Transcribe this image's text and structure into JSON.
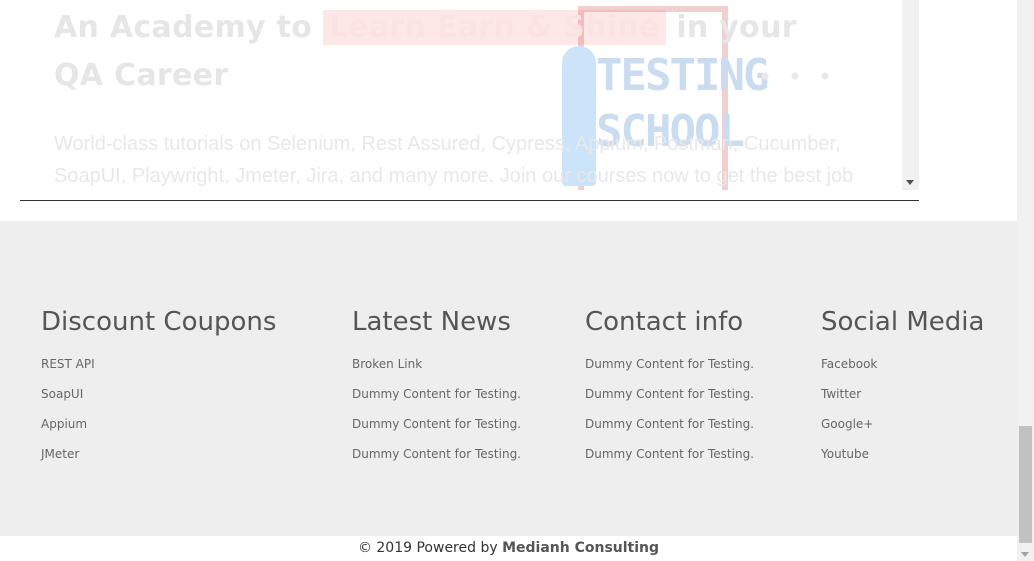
{
  "iframe": {
    "title_before": "An Academy to",
    "title_highlight": "Learn Earn & Shine",
    "title_after": "in your QA Career",
    "description": "World-class tutorials on Selenium, Rest Assured, Cypress, Appium, Postman, Cucumber, SoapUI, Playwright, Jmeter, Jira, and many more. Join our courses now to get the best job",
    "logo_line1": "TESTING",
    "logo_line2": "SCHOOL"
  },
  "footer": {
    "columns": [
      {
        "heading": "Discount Coupons",
        "items": [
          "REST API",
          "SoapUI",
          "Appium",
          "JMeter"
        ]
      },
      {
        "heading": "Latest News",
        "items": [
          "Broken Link",
          "Dummy Content for Testing.",
          "Dummy Content for Testing.",
          "Dummy Content for Testing."
        ]
      },
      {
        "heading": "Contact info",
        "items": [
          "Dummy Content for Testing.",
          "Dummy Content for Testing.",
          "Dummy Content for Testing.",
          "Dummy Content for Testing."
        ]
      },
      {
        "heading": "Social Media",
        "items": [
          "Facebook",
          "Twitter",
          "Google+",
          "Youtube"
        ]
      }
    ],
    "copyright_prefix": "© 2019 Powered by",
    "copyright_brand": "Medianh Consulting"
  },
  "colors": {
    "footer_bg": "#eeeeee",
    "heading": "#555555",
    "link": "#666666",
    "highlight": "#f44336"
  }
}
